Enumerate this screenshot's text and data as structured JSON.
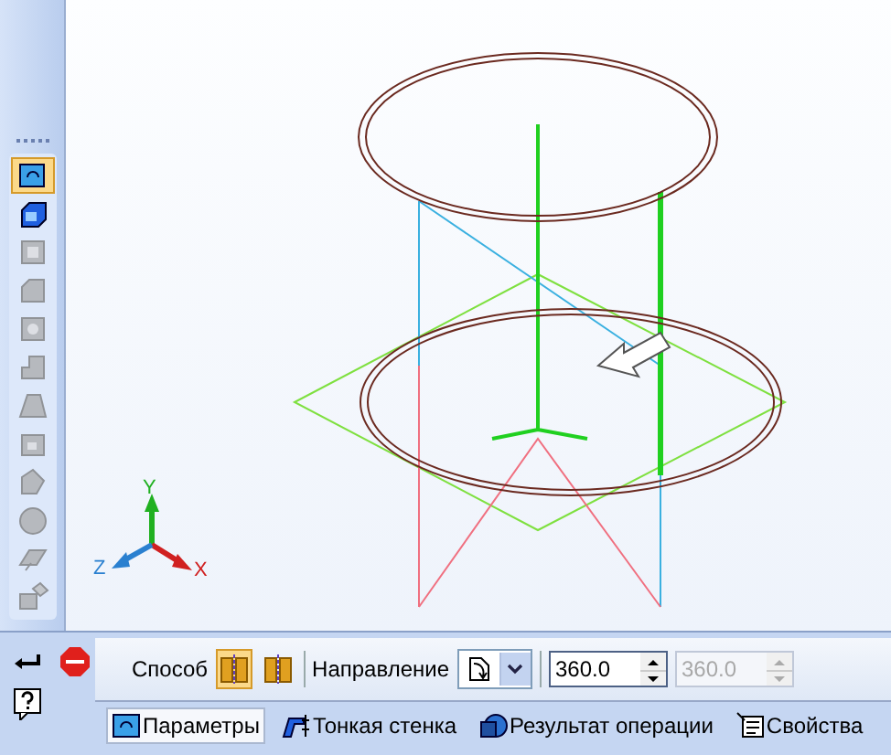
{
  "toolbar": {
    "tools": [
      {
        "selected": true,
        "disabled": false
      },
      {
        "selected": false,
        "disabled": false
      },
      {
        "selected": false,
        "disabled": true
      },
      {
        "selected": false,
        "disabled": true
      },
      {
        "selected": false,
        "disabled": true
      },
      {
        "selected": false,
        "disabled": true
      },
      {
        "selected": false,
        "disabled": true
      },
      {
        "selected": false,
        "disabled": true
      },
      {
        "selected": false,
        "disabled": true
      },
      {
        "selected": false,
        "disabled": true
      },
      {
        "selected": false,
        "disabled": true
      },
      {
        "selected": false,
        "disabled": true
      }
    ]
  },
  "axes": {
    "y": "Y",
    "z": "Z",
    "x": "X"
  },
  "properties": {
    "method": {
      "label": "Способ",
      "options": [
        {
          "selected": true
        },
        {
          "selected": false
        }
      ]
    },
    "direction": {
      "label": "Направление"
    },
    "angle_1": {
      "value": "360.0",
      "disabled": false
    },
    "angle_2": {
      "value": "360.0",
      "disabled": true
    }
  },
  "tabs": [
    {
      "label": "Параметры",
      "selected": true
    },
    {
      "label": "Тонкая стенка",
      "selected": false
    },
    {
      "label": "Результат операции",
      "selected": false
    },
    {
      "label": "Свойства",
      "selected": false
    }
  ]
}
